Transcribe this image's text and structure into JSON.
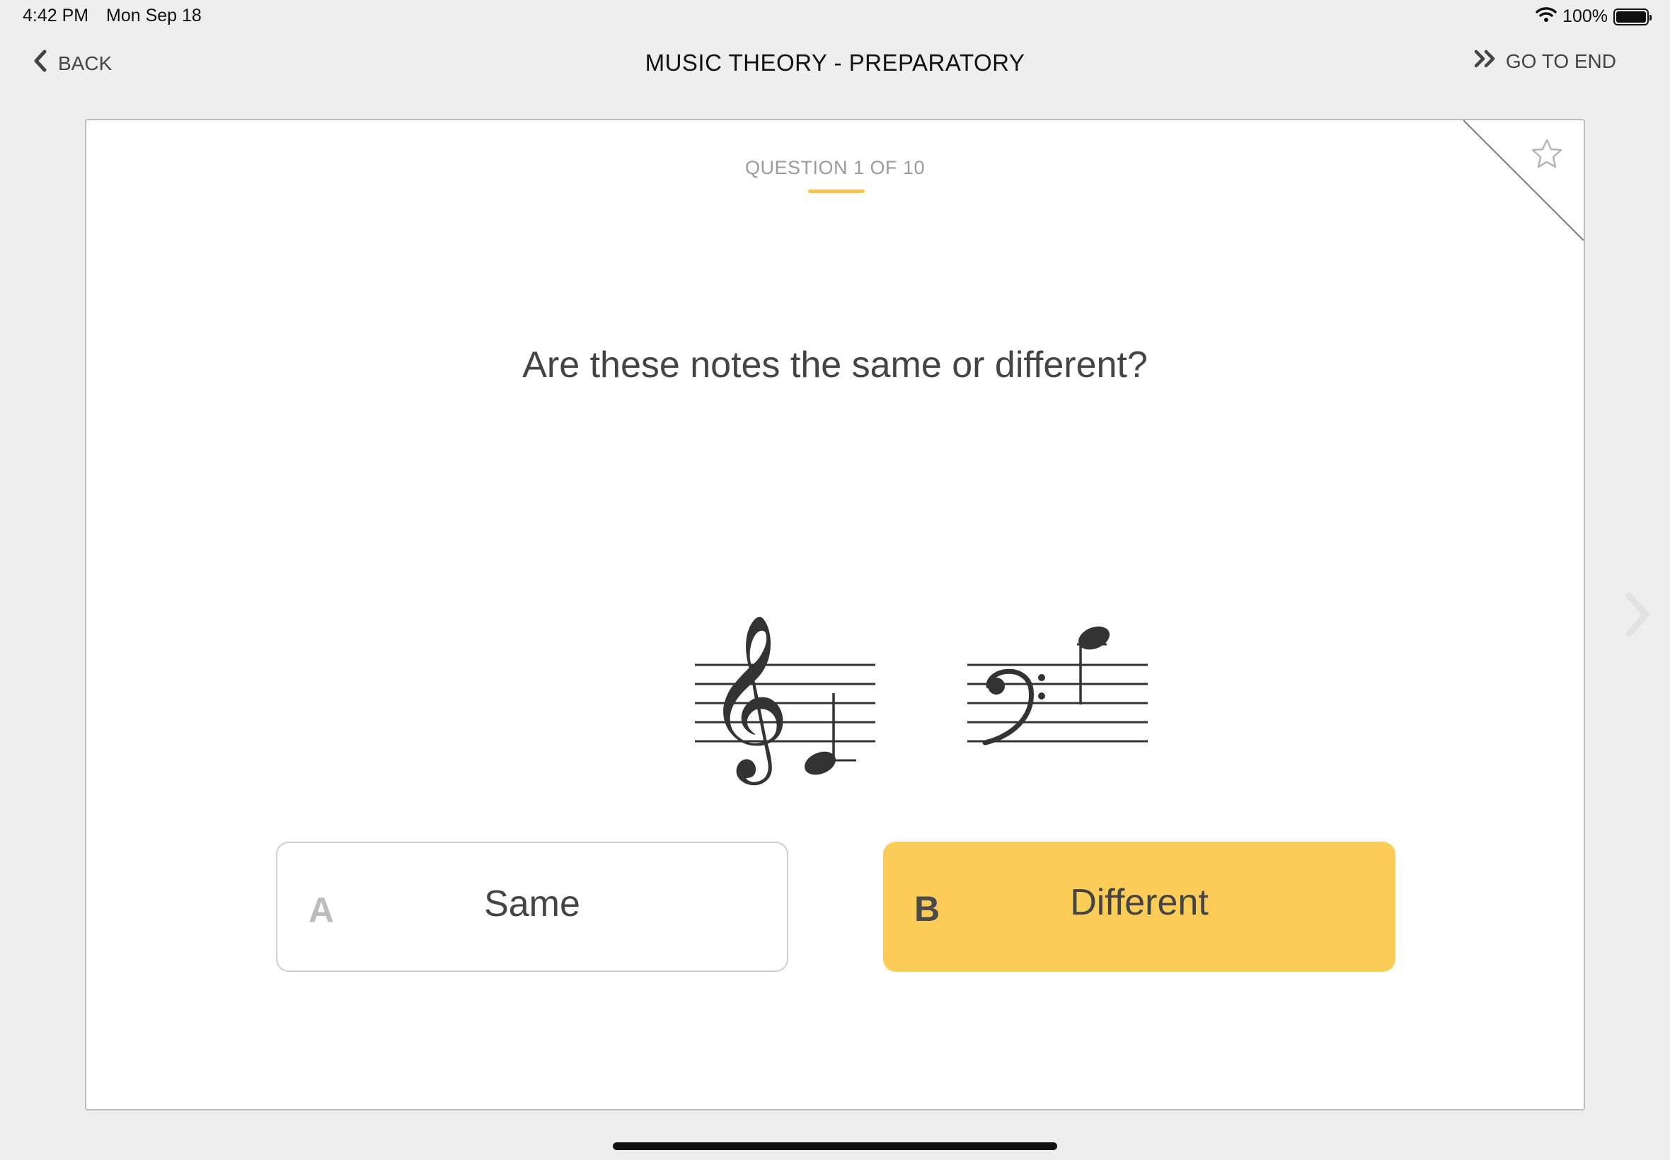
{
  "status": {
    "time": "4:42 PM",
    "date": "Mon Sep 18",
    "battery": "100%",
    "battery_level": 1.0
  },
  "nav": {
    "back_label": "BACK",
    "title": "MUSIC THEORY - PREPARATORY",
    "go_to_end_label": "GO TO END"
  },
  "card": {
    "counter": "QUESTION 1 OF 10",
    "question": "Are these notes the same or different?",
    "answers": [
      {
        "letter": "A",
        "text": "Same",
        "selected": false
      },
      {
        "letter": "B",
        "text": "Different",
        "selected": true
      }
    ]
  },
  "colors": {
    "accent": "#fbcc57",
    "underline": "#f7c34a",
    "background": "#eeeeee"
  },
  "icons": [
    "back-chevron-icon",
    "double-chevron-icon",
    "star-icon",
    "wifi-icon",
    "battery-icon",
    "next-chevron-icon"
  ]
}
